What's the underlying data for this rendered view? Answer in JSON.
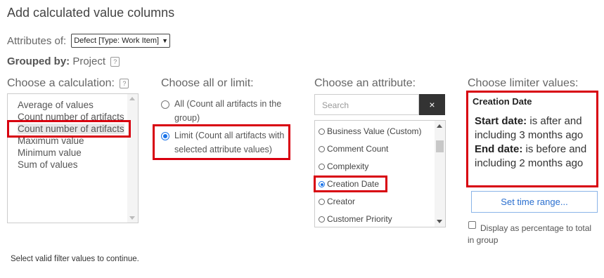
{
  "title": "Add calculated value columns",
  "attributes_of": {
    "label": "Attributes of:",
    "selected": "Defect [Type: Work Item]"
  },
  "grouped_by": {
    "label": "Grouped by:",
    "value": "Project"
  },
  "calculation": {
    "heading": "Choose a calculation:",
    "items": [
      "Average of values",
      "Count number of artifacts",
      "Count number of artifacts",
      "Maximum value",
      "Minimum value",
      "Sum of values"
    ],
    "selected_index": 2
  },
  "limit": {
    "heading": "Choose all or limit:",
    "options": [
      {
        "line1": "All (Count all artifacts in the",
        "line2": "group)",
        "selected": false
      },
      {
        "line1": "Limit (Count all artifacts with",
        "line2": "selected attribute values)",
        "selected": true
      }
    ]
  },
  "attribute": {
    "heading": "Choose an attribute:",
    "search_placeholder": "Search",
    "search_button": "×",
    "items": [
      {
        "label": "Business Value (Custom)",
        "selected": false
      },
      {
        "label": "Comment Count",
        "selected": false
      },
      {
        "label": "Complexity",
        "selected": false
      },
      {
        "label": "Creation Date",
        "selected": true
      },
      {
        "label": "Creator",
        "selected": false
      },
      {
        "label": "Customer Priority",
        "selected": false
      }
    ]
  },
  "limiter": {
    "heading": "Choose limiter values:",
    "title": "Creation Date",
    "start_label": "Start date:",
    "start_value": "is after and including 3 months ago",
    "end_label": "End date:",
    "end_value": "is before and including 2 months ago",
    "time_range_button": "Set time range...",
    "percentage_label_line1": "Display as percentage to total",
    "percentage_label_line2": "in group",
    "percentage_checked": false
  },
  "footer_message": "Select valid filter values to continue.",
  "colors": {
    "highlight_border": "#d8000f",
    "accent": "#1a73e8",
    "search_button_bg": "#333333"
  }
}
